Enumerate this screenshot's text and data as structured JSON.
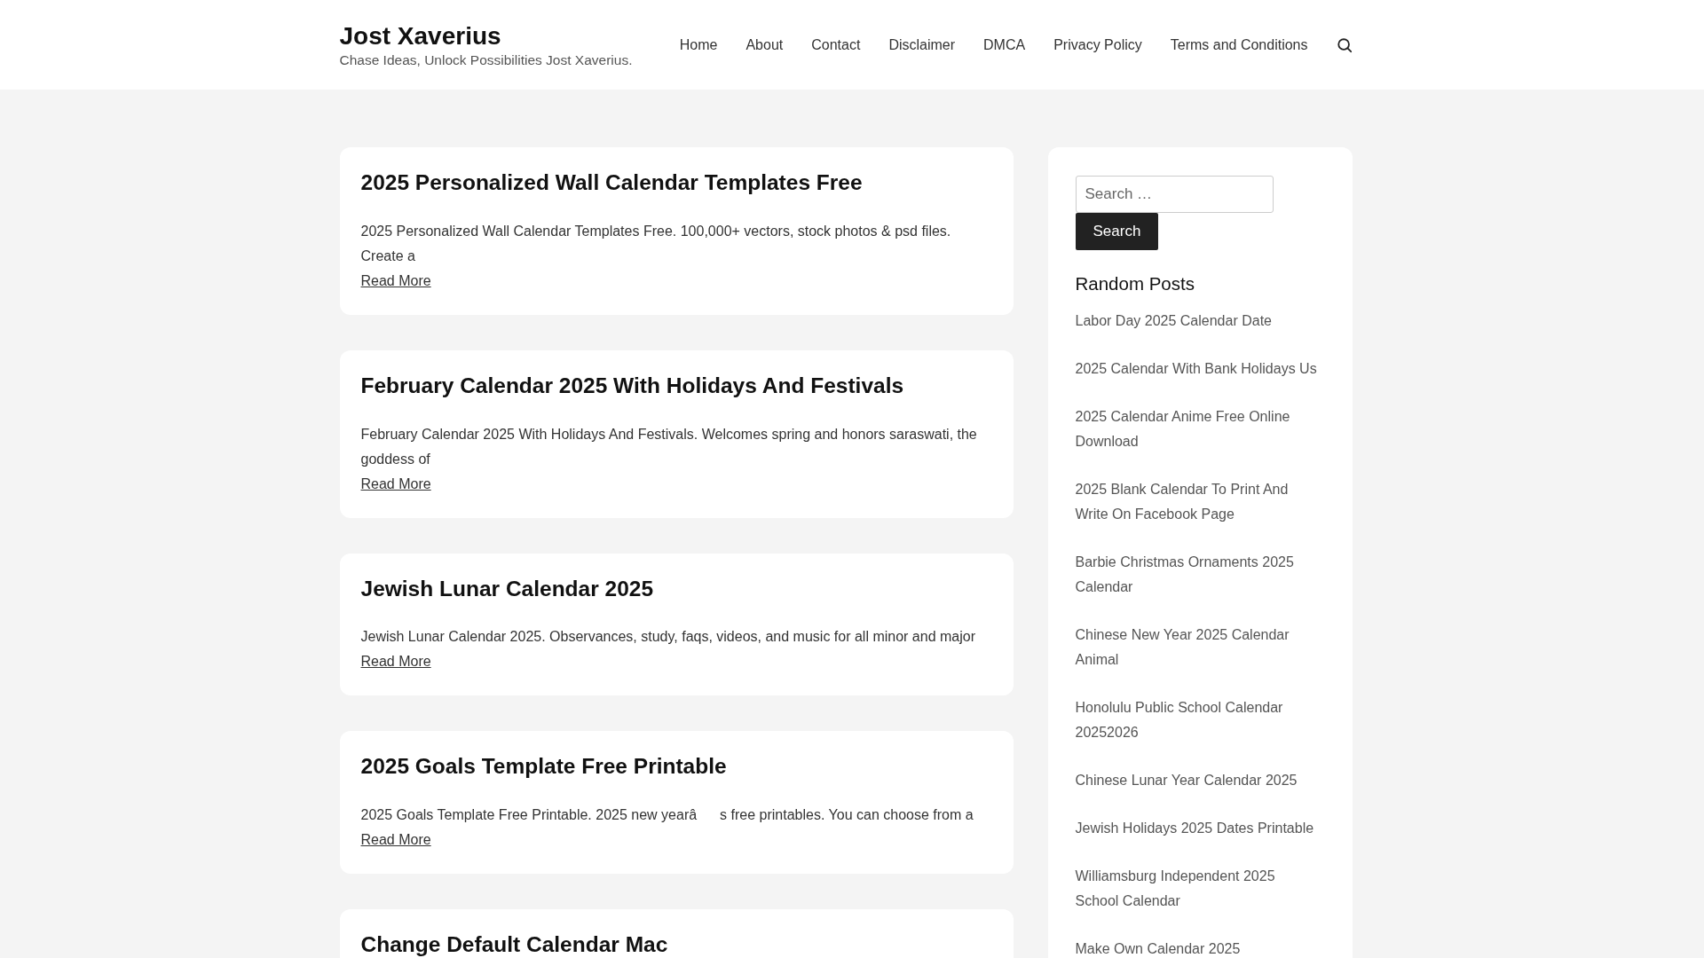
{
  "site": {
    "title": "Jost Xaverius",
    "tagline": "Chase Ideas, Unlock Possibilities Jost Xaverius."
  },
  "nav": [
    {
      "label": "Home"
    },
    {
      "label": "About"
    },
    {
      "label": "Contact"
    },
    {
      "label": "Disclaimer"
    },
    {
      "label": "DMCA"
    },
    {
      "label": "Privacy Policy"
    },
    {
      "label": "Terms and Conditions"
    }
  ],
  "posts": [
    {
      "title": "2025 Personalized Wall Calendar Templates Free",
      "excerpt": "2025 Personalized Wall Calendar Templates Free. 100,000+ vectors, stock photos & psd files. Create a",
      "link": "Read More"
    },
    {
      "title": "February Calendar 2025 With Holidays And Festivals",
      "excerpt": "February Calendar 2025 With Holidays And Festivals. Welcomes spring and honors saraswati, the goddess of",
      "link": "Read More"
    },
    {
      "title": "Jewish Lunar Calendar 2025",
      "excerpt": "Jewish Lunar Calendar 2025. Observances, study, faqs, videos, and music for all minor and major",
      "link": "Read More"
    },
    {
      "title": "2025 Goals Template Free Printable",
      "excerpt": "2025 Goals Template Free Printable. 2025 new yearâs free printables. You can choose from a",
      "link": "Read More"
    },
    {
      "title": "Change Default Calendar Mac"
    }
  ],
  "sidebar": {
    "search": {
      "placeholder": "Search …",
      "button": "Search"
    },
    "heading": "Random Posts",
    "items": [
      "Labor Day 2025 Calendar Date",
      "2025 Calendar With Bank Holidays Us",
      "2025 Calendar Anime Free Online Download",
      "2025 Blank Calendar To Print And Write On Facebook Page",
      "Barbie Christmas Ornaments 2025 Calendar",
      "Chinese New Year 2025 Calendar Animal",
      "Honolulu Public School Calendar 20252026",
      "Chinese Lunar Year Calendar 2025",
      "Jewish Holidays 2025 Dates Printable",
      "Williamsburg Independent 2025 School Calendar",
      "Make Own Calendar 2025"
    ]
  }
}
